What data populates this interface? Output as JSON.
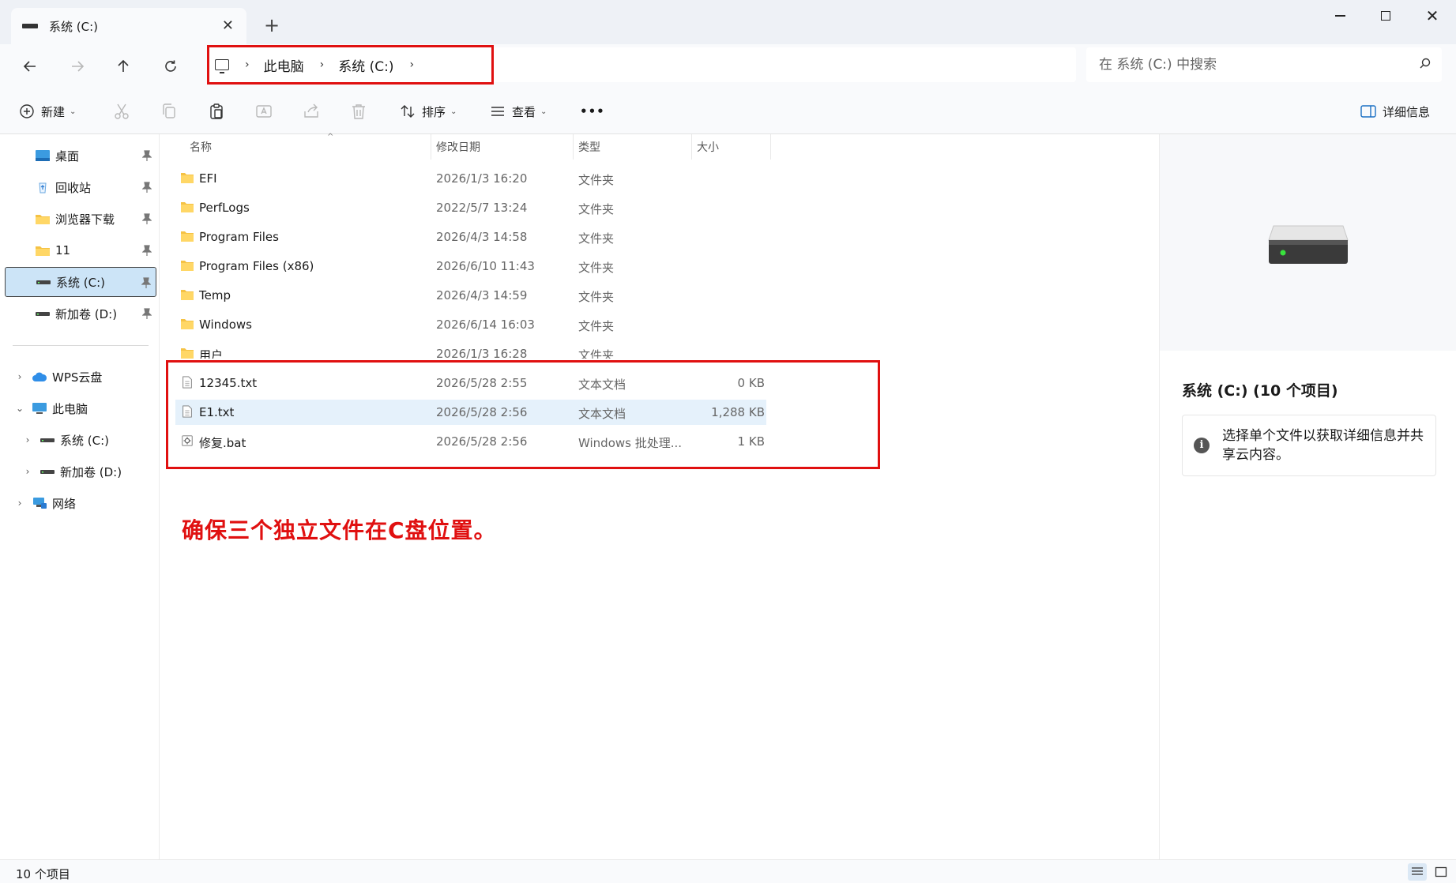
{
  "window": {
    "tab_title": "系统 (C:)",
    "new_tab_label": "+"
  },
  "nav": {
    "breadcrumb": [
      "此电脑",
      "系统 (C:)"
    ],
    "search_placeholder": "在 系统 (C:) 中搜索"
  },
  "toolbar": {
    "new_label": "新建",
    "sort_label": "排序",
    "view_label": "查看",
    "more_label": "•••",
    "details_label": "详细信息"
  },
  "sidebar": {
    "quick_access": [
      {
        "label": "桌面",
        "icon": "desktop-icon"
      },
      {
        "label": "回收站",
        "icon": "recycle-bin-icon"
      },
      {
        "label": "浏览器下载",
        "icon": "folder-icon"
      },
      {
        "label": "11",
        "icon": "folder-icon"
      },
      {
        "label": "系统 (C:)",
        "icon": "drive-icon",
        "selected": true
      },
      {
        "label": "新加卷 (D:)",
        "icon": "drive-icon"
      }
    ],
    "tree": [
      {
        "label": "WPS云盘",
        "icon": "cloud-icon",
        "chevron": "›"
      },
      {
        "label": "此电脑",
        "icon": "computer-icon",
        "chevron": "⌄"
      },
      {
        "label": "系统 (C:)",
        "icon": "drive-icon",
        "chevron": "›"
      },
      {
        "label": "新加卷 (D:)",
        "icon": "drive-icon",
        "chevron": "›"
      },
      {
        "label": "网络",
        "icon": "network-icon",
        "chevron": "›"
      }
    ]
  },
  "columns": {
    "name": "名称",
    "date": "修改日期",
    "type": "类型",
    "size": "大小"
  },
  "files": [
    {
      "name": "EFI",
      "date": "2026/1/3 16:20",
      "type": "文件夹",
      "size": "",
      "icon": "folder-icon"
    },
    {
      "name": "PerfLogs",
      "date": "2022/5/7 13:24",
      "type": "文件夹",
      "size": "",
      "icon": "folder-icon"
    },
    {
      "name": "Program Files",
      "date": "2026/4/3 14:58",
      "type": "文件夹",
      "size": "",
      "icon": "folder-icon"
    },
    {
      "name": "Program Files (x86)",
      "date": "2026/6/10 11:43",
      "type": "文件夹",
      "size": "",
      "icon": "folder-icon"
    },
    {
      "name": "Temp",
      "date": "2026/4/3 14:59",
      "type": "文件夹",
      "size": "",
      "icon": "folder-icon"
    },
    {
      "name": "Windows",
      "date": "2026/6/14 16:03",
      "type": "文件夹",
      "size": "",
      "icon": "folder-icon"
    },
    {
      "name": "用户",
      "date": "2026/1/3 16:28",
      "type": "文件夹",
      "size": "",
      "icon": "folder-icon"
    },
    {
      "name": "12345.txt",
      "date": "2026/5/28 2:55",
      "type": "文本文档",
      "size": "0 KB",
      "icon": "text-file-icon"
    },
    {
      "name": "E1.txt",
      "date": "2026/5/28 2:56",
      "type": "文本文档",
      "size": "1,288 KB",
      "icon": "text-file-icon"
    },
    {
      "name": "修复.bat",
      "date": "2026/5/28 2:56",
      "type": "Windows 批处理...",
      "size": "1 KB",
      "icon": "batch-file-icon"
    }
  ],
  "annotation": "确保三个独立文件在C盘位置。",
  "details": {
    "title": "系统 (C:) (10 个项目)",
    "info": "选择单个文件以获取详细信息并共享云内容。"
  },
  "status": {
    "item_count": "10 个项目"
  },
  "colors": {
    "highlight_red": "#e01010",
    "selection_blue": "#cce4f7",
    "folder_yellow": "#f5c244"
  }
}
